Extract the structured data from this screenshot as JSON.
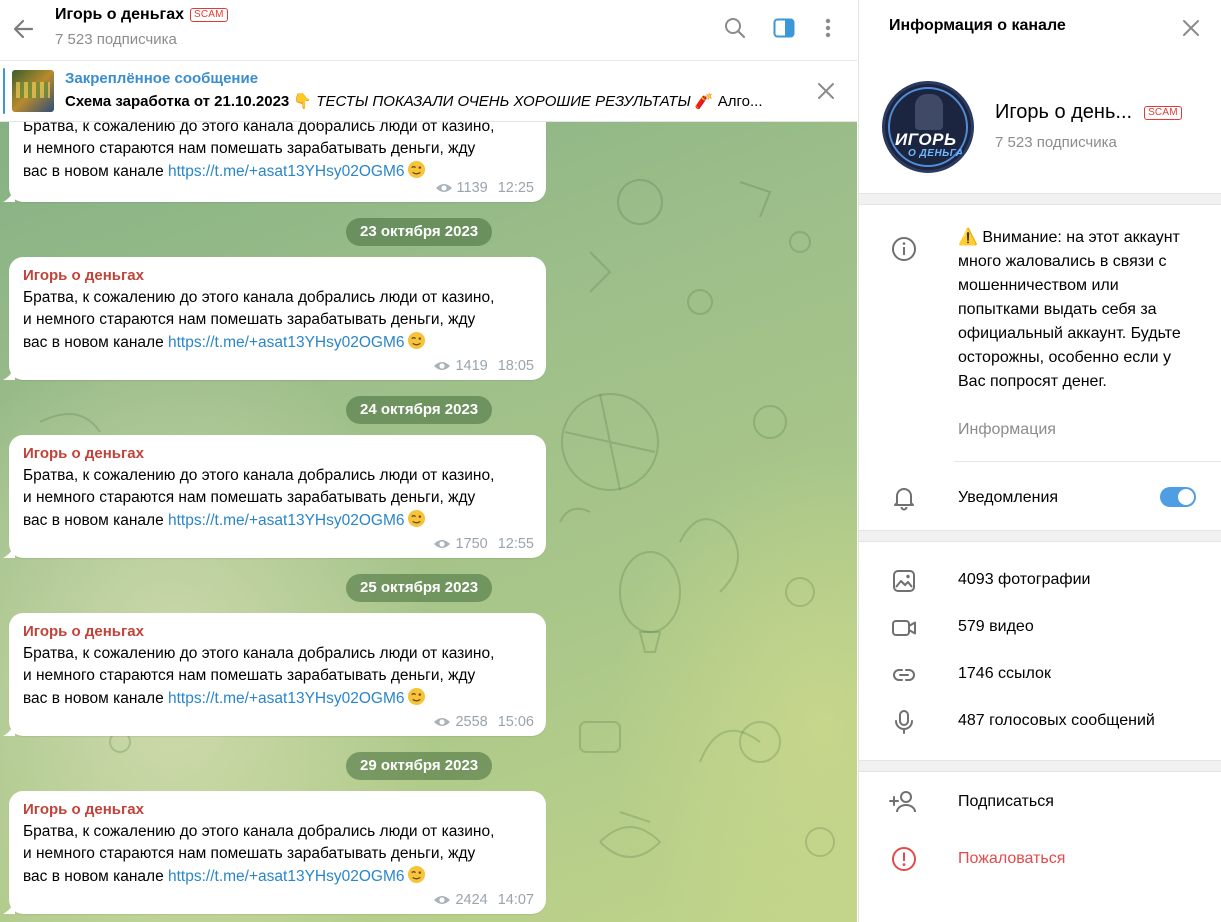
{
  "chat": {
    "title": "Игорь о деньгах",
    "scam_badge": "SCAM",
    "subtitle": "7 523 подписчика"
  },
  "pinned": {
    "label": "Закреплённое сообщение",
    "text_bold": "Схема заработка от 21.10.2023 👇",
    "text_italic": "ТЕСТЫ ПОКАЗАЛИ ОЧЕНЬ ХОРОШИЕ РЕЗУЛЬТАТЫ",
    "text_tail": "🧨 Алго..."
  },
  "messages": [
    {
      "author": "",
      "line1": "Братва, к сожалению до этого канала добрались люди от казино,",
      "line2": "и немного стараются нам помешать зарабатывать деньги, жду",
      "line3_prefix": "вас в новом канале ",
      "link": "https://t.me/+asat13YHsy02OGM6",
      "views": "1139",
      "time": "12:25"
    },
    {
      "author": "Игорь о деньгах",
      "line1": "Братва, к сожалению до этого канала добрались люди от казино,",
      "line2": "и немного стараются нам помешать зарабатывать деньги, жду",
      "line3_prefix": "вас в новом канале ",
      "link": "https://t.me/+asat13YHsy02OGM6",
      "views": "1419",
      "time": "18:05"
    },
    {
      "author": "Игорь о деньгах",
      "line1": "Братва, к сожалению до этого канала добрались люди от казино,",
      "line2": "и немного стараются нам помешать зарабатывать деньги, жду",
      "line3_prefix": "вас в новом канале ",
      "link": "https://t.me/+asat13YHsy02OGM6",
      "views": "1750",
      "time": "12:55"
    },
    {
      "author": "Игорь о деньгах",
      "line1": "Братва, к сожалению до этого канала добрались люди от казино,",
      "line2": "и немного стараются нам помешать зарабатывать деньги, жду",
      "line3_prefix": "вас в новом канале ",
      "link": "https://t.me/+asat13YHsy02OGM6",
      "views": "2558",
      "time": "15:06"
    },
    {
      "author": "Игорь о деньгах",
      "line1": "Братва, к сожалению до этого канала добрались люди от казино,",
      "line2": "и немного стараются нам помешать зарабатывать деньги, жду",
      "line3_prefix": "вас в новом канале ",
      "link": "https://t.me/+asat13YHsy02OGM6",
      "views": "2424",
      "time": "14:07"
    }
  ],
  "dates": [
    "23 октября 2023",
    "24 октября 2023",
    "25 октября 2023",
    "29 октября 2023"
  ],
  "info": {
    "title": "Информация о канале",
    "avatar_line1": "ИГОРЬ",
    "avatar_line2": "О ДЕНЬГАХ",
    "name": "Игорь о день...",
    "scam_badge": "SCAM",
    "subs": "7 523 подписчика",
    "warning": "⚠️ Внимание: на этот аккаунт много жаловались в связи с мошенничеством или попытками выдать себя за официальный аккаунт. Будьте осторожны, особенно если у Вас попросят денег.",
    "warning_label": "Информация",
    "notifications": "Уведомления",
    "notifications_on": true,
    "photos": "4093 фотографии",
    "videos": "579 видео",
    "links": "1746 ссылок",
    "voice": "487 голосовых сообщений",
    "subscribe": "Подписаться",
    "report": "Пожаловаться"
  },
  "colors": {
    "accent": "#3a8ecf",
    "link": "#2a86c7",
    "author": "#c0443a",
    "scam": "#e53935",
    "report": "#e14b4b",
    "toggle": "#4f9ee3"
  },
  "icons": [
    "back-arrow-icon",
    "search-icon",
    "sidebar-toggle-icon",
    "more-vertical-icon",
    "close-icon",
    "eye-icon",
    "wink-emoji-icon",
    "info-circle-icon",
    "bell-icon",
    "photo-icon",
    "video-icon",
    "link-icon",
    "microphone-icon",
    "add-user-icon",
    "report-icon"
  ]
}
